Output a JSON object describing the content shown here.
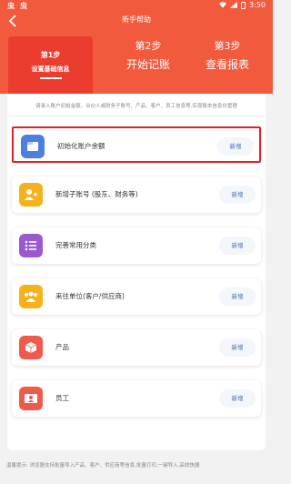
{
  "status": {
    "left_a": "虫",
    "left_b": "虫",
    "time": "3:50"
  },
  "header": {
    "title": "新手帮助"
  },
  "steps": [
    {
      "num": "第1步",
      "title": "设置基础信息"
    },
    {
      "num": "第2步",
      "title": "开始记账"
    },
    {
      "num": "第3步",
      "title": "查看报表"
    }
  ],
  "hint": "请录入账户初始金额、合伙人或财务子账号、产品、客户、员工信息等,实现账本信息化管理",
  "items": [
    {
      "label": "初始化账户余额",
      "button": "新增",
      "icon": "wallet-icon",
      "color": "#4d7fe0"
    },
    {
      "label": "新增子账号 (股东、财务等)",
      "button": "新增",
      "icon": "user-add-icon",
      "color": "#f5b21b"
    },
    {
      "label": "完善常用分类",
      "button": "新增",
      "icon": "list-icon",
      "color": "#9b59d0"
    },
    {
      "label": "来往单位(客户/供应商)",
      "button": "新增",
      "icon": "group-icon",
      "color": "#f5b21b"
    },
    {
      "label": "产品",
      "button": "新增",
      "icon": "box-icon",
      "color": "#ef5a4c"
    },
    {
      "label": "员工",
      "button": "新增",
      "icon": "id-card-icon",
      "color": "#ef5a4c"
    }
  ],
  "footer": "温馨提示: 浏览器支持批量导入产品、客户、供应商等信息,批量打印,一键导入,高效快捷",
  "colors": {
    "header": "#f25a3e",
    "active_step": "#ea3d30",
    "highlight": "#e0202b",
    "button_text": "#4a6fb5"
  }
}
